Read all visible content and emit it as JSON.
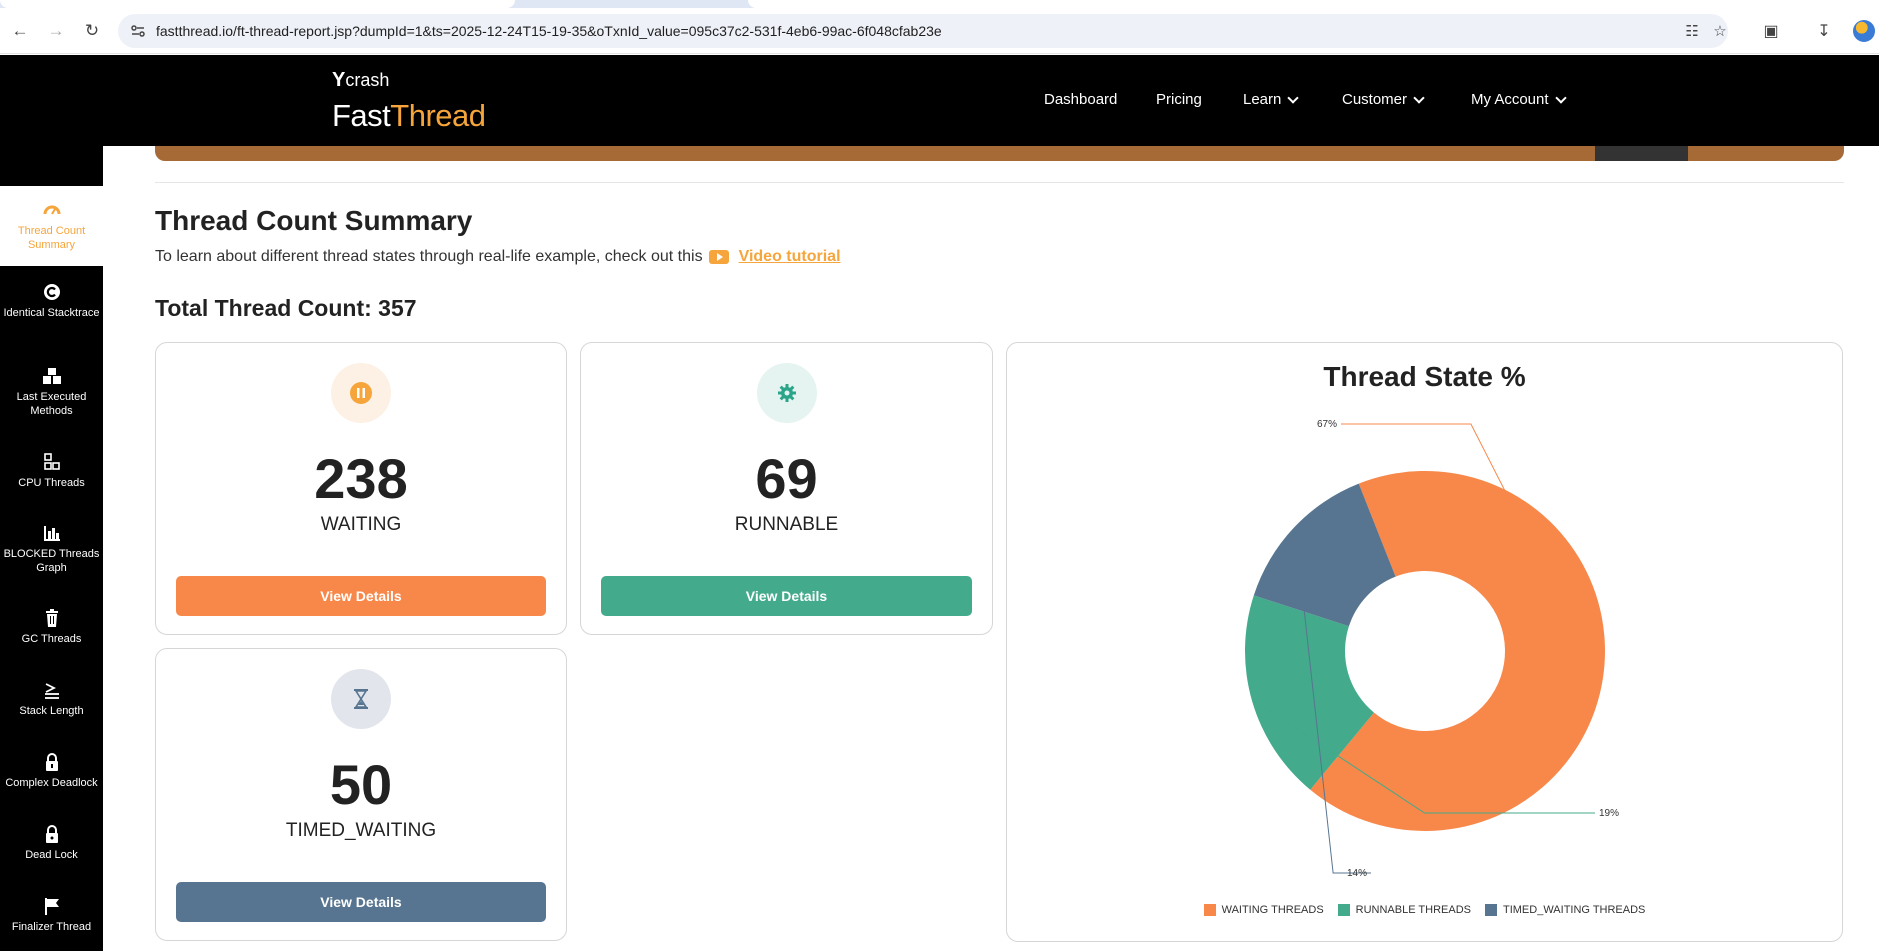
{
  "browser": {
    "url": "fastthread.io/ft-thread-report.jsp?dumpId=1&ts=2025-12-24T15-19-35&oTxnId_value=095c37c2-531f-4eb6-99ac-6f048cfab23e"
  },
  "header": {
    "logo_top": "crash",
    "logo_y": "Y",
    "logo_fast": "Fast",
    "logo_thread": "Thread",
    "nav": [
      {
        "label": "Dashboard"
      },
      {
        "label": "Pricing"
      },
      {
        "label": "Learn"
      },
      {
        "label": "Customer"
      },
      {
        "label": "My Account"
      }
    ]
  },
  "sidebar": {
    "items": [
      {
        "label": "Thread Count Summary",
        "icon": "gauge-icon"
      },
      {
        "label": "Identical Stacktrace",
        "icon": "copyright-icon"
      },
      {
        "label": "Last Executed Methods",
        "icon": "boxes-icon"
      },
      {
        "label": "CPU Threads",
        "icon": "cpu-icon"
      },
      {
        "label": "BLOCKED Threads Graph",
        "icon": "bar-chart-icon"
      },
      {
        "label": "GC Threads",
        "icon": "trash-icon"
      },
      {
        "label": "Stack Length",
        "icon": "stack-icon"
      },
      {
        "label": "Complex Deadlock",
        "icon": "lock-icon"
      },
      {
        "label": "Dead Lock",
        "icon": "lock-icon"
      },
      {
        "label": "Finalizer Thread",
        "icon": "flag-icon"
      }
    ]
  },
  "main": {
    "title": "Thread Count Summary",
    "subtitle": "To learn about different thread states through real-life example, check out this",
    "video_link": "Video tutorial",
    "total": "Total Thread Count: 357",
    "cards": [
      {
        "count": "238",
        "state": "WAITING",
        "button": "View Details",
        "color": "#f7884a",
        "icon": "pause-icon"
      },
      {
        "count": "69",
        "state": "RUNNABLE",
        "button": "View Details",
        "color": "#43aa8b",
        "icon": "gear-icon"
      },
      {
        "count": "50",
        "state": "TIMED_WAITING",
        "button": "View Details",
        "color": "#577590",
        "icon": "hourglass-icon"
      }
    ]
  },
  "chart_data": {
    "type": "pie",
    "title": "Thread State %",
    "categories": [
      "WAITING THREADS",
      "RUNNABLE THREADS",
      "TIMED_WAITING THREADS"
    ],
    "values": [
      67,
      19,
      14
    ],
    "value_labels": [
      "67%",
      "19%",
      "14%"
    ],
    "colors": [
      "#f7884a",
      "#43aa8b",
      "#577590"
    ],
    "donut": true,
    "legend": "bottom"
  }
}
